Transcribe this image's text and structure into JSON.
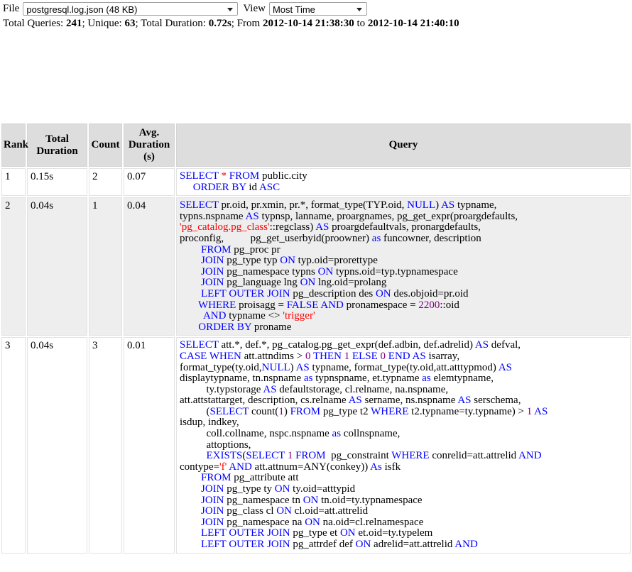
{
  "toolbar": {
    "file_label": "File",
    "file_select_value": "postgresql.log.json (48 KB)",
    "view_label": "View",
    "view_select_value": "Most Time"
  },
  "summary": {
    "total_queries_label": "Total Queries:",
    "total_queries_value": "241",
    "sep1": ";",
    "unique_label": "Unique:",
    "unique_value": "63",
    "sep2": ";",
    "duration_label": "Total Duration:",
    "duration_value": "0.72s",
    "sep3": ";",
    "from_label": "From",
    "from_value": "2012-10-14 21:38:30",
    "to_label": "to",
    "to_value": "2012-10-14 21:40:10"
  },
  "table": {
    "headers": {
      "rank": "Rank",
      "total_duration": "Total Duration",
      "count": "Count",
      "avg_duration": "Avg. Duration (s)",
      "query": "Query"
    },
    "rows": [
      {
        "rank": "1",
        "total_duration": "0.15s",
        "count": "2",
        "avg_duration": "0.07",
        "query_tokens": [
          {
            "t": "SELECT",
            "c": "kw"
          },
          {
            "t": " ",
            "c": ""
          },
          {
            "t": "*",
            "c": "str"
          },
          {
            "t": " ",
            "c": ""
          },
          {
            "t": "FROM",
            "c": "kw"
          },
          {
            "t": " public.city\n     ",
            "c": ""
          },
          {
            "t": "ORDER",
            "c": "kw"
          },
          {
            "t": " ",
            "c": ""
          },
          {
            "t": "BY",
            "c": "kw"
          },
          {
            "t": " id ",
            "c": ""
          },
          {
            "t": "ASC",
            "c": "kw"
          }
        ]
      },
      {
        "rank": "2",
        "total_duration": "0.04s",
        "count": "1",
        "avg_duration": "0.04",
        "query_tokens": [
          {
            "t": "SELECT",
            "c": "kw"
          },
          {
            "t": " pr.oid, pr.xmin, pr.*, format_type(TYP.oid, ",
            "c": ""
          },
          {
            "t": "NULL",
            "c": "kw"
          },
          {
            "t": ") ",
            "c": ""
          },
          {
            "t": "AS",
            "c": "kw"
          },
          {
            "t": " typname,\ntypns.nspname ",
            "c": ""
          },
          {
            "t": "AS",
            "c": "kw"
          },
          {
            "t": " typnsp, lanname, proargnames, pg_get_expr(proargdefaults,\n",
            "c": ""
          },
          {
            "t": "'pg_catalog.pg_class'",
            "c": "str"
          },
          {
            "t": "::regclass) ",
            "c": ""
          },
          {
            "t": "AS",
            "c": "kw"
          },
          {
            "t": " proargdefaultvals, pronargdefaults,\nproconfig,          pg_get_userbyid(proowner) ",
            "c": ""
          },
          {
            "t": "as",
            "c": "kw"
          },
          {
            "t": " funcowner, description\n        ",
            "c": ""
          },
          {
            "t": "FROM",
            "c": "kw"
          },
          {
            "t": " pg_proc pr\n        ",
            "c": ""
          },
          {
            "t": "JOIN",
            "c": "kw"
          },
          {
            "t": " pg_type typ ",
            "c": ""
          },
          {
            "t": "ON",
            "c": "kw"
          },
          {
            "t": " typ.oid=prorettype\n        ",
            "c": ""
          },
          {
            "t": "JOIN",
            "c": "kw"
          },
          {
            "t": " pg_namespace typns ",
            "c": ""
          },
          {
            "t": "ON",
            "c": "kw"
          },
          {
            "t": " typns.oid=typ.typnamespace\n        ",
            "c": ""
          },
          {
            "t": "JOIN",
            "c": "kw"
          },
          {
            "t": " pg_language lng ",
            "c": ""
          },
          {
            "t": "ON",
            "c": "kw"
          },
          {
            "t": " lng.oid=prolang\n        ",
            "c": ""
          },
          {
            "t": "LEFT",
            "c": "kw"
          },
          {
            "t": " ",
            "c": ""
          },
          {
            "t": "OUTER",
            "c": "kw"
          },
          {
            "t": " ",
            "c": ""
          },
          {
            "t": "JOIN",
            "c": "kw"
          },
          {
            "t": " pg_description des ",
            "c": ""
          },
          {
            "t": "ON",
            "c": "kw"
          },
          {
            "t": " des.objoid=pr.oid\n       ",
            "c": ""
          },
          {
            "t": "WHERE",
            "c": "kw"
          },
          {
            "t": " proisagg = ",
            "c": ""
          },
          {
            "t": "FALSE",
            "c": "kw"
          },
          {
            "t": " ",
            "c": ""
          },
          {
            "t": "AND",
            "c": "kw"
          },
          {
            "t": " pronamespace = ",
            "c": ""
          },
          {
            "t": "2200",
            "c": "num2"
          },
          {
            "t": "::oid\n         ",
            "c": ""
          },
          {
            "t": "AND",
            "c": "kw"
          },
          {
            "t": " typname <> ",
            "c": ""
          },
          {
            "t": "'trigger'",
            "c": "str"
          },
          {
            "t": "\n       ",
            "c": ""
          },
          {
            "t": "ORDER",
            "c": "kw"
          },
          {
            "t": " ",
            "c": ""
          },
          {
            "t": "BY",
            "c": "kw"
          },
          {
            "t": " proname",
            "c": ""
          }
        ]
      },
      {
        "rank": "3",
        "total_duration": "0.04s",
        "count": "3",
        "avg_duration": "0.01",
        "query_tokens": [
          {
            "t": "SELECT",
            "c": "kw"
          },
          {
            "t": " att.*, def.*, pg_catalog.pg_get_expr(def.adbin, def.adrelid) ",
            "c": ""
          },
          {
            "t": "AS",
            "c": "kw"
          },
          {
            "t": " defval,\n",
            "c": ""
          },
          {
            "t": "CASE",
            "c": "kw"
          },
          {
            "t": " ",
            "c": ""
          },
          {
            "t": "WHEN",
            "c": "kw"
          },
          {
            "t": " att.attndims > ",
            "c": ""
          },
          {
            "t": "0",
            "c": "num2"
          },
          {
            "t": " ",
            "c": ""
          },
          {
            "t": "THEN",
            "c": "kw"
          },
          {
            "t": " ",
            "c": ""
          },
          {
            "t": "1",
            "c": "num2"
          },
          {
            "t": " ",
            "c": ""
          },
          {
            "t": "ELSE",
            "c": "kw"
          },
          {
            "t": " ",
            "c": ""
          },
          {
            "t": "0",
            "c": "num2"
          },
          {
            "t": " ",
            "c": ""
          },
          {
            "t": "END",
            "c": "kw"
          },
          {
            "t": " ",
            "c": ""
          },
          {
            "t": "AS",
            "c": "kw"
          },
          {
            "t": " isarray,\nformat_type(ty.oid,",
            "c": ""
          },
          {
            "t": "NULL",
            "c": "kw"
          },
          {
            "t": ") ",
            "c": ""
          },
          {
            "t": "AS",
            "c": "kw"
          },
          {
            "t": " typname, format_type(ty.oid,att.atttypmod) ",
            "c": ""
          },
          {
            "t": "AS",
            "c": "kw"
          },
          {
            "t": "\ndisplaytypname, tn.nspname ",
            "c": ""
          },
          {
            "t": "as",
            "c": "kw"
          },
          {
            "t": " typnspname, et.typname ",
            "c": ""
          },
          {
            "t": "as",
            "c": "kw"
          },
          {
            "t": " elemtypname,\n          ty.typstorage ",
            "c": ""
          },
          {
            "t": "AS",
            "c": "kw"
          },
          {
            "t": " defaultstorage, cl.relname, na.nspname,\natt.attstattarget, description, cs.relname ",
            "c": ""
          },
          {
            "t": "AS",
            "c": "kw"
          },
          {
            "t": " sername, ns.nspname ",
            "c": ""
          },
          {
            "t": "AS",
            "c": "kw"
          },
          {
            "t": " serschema,\n          (",
            "c": ""
          },
          {
            "t": "SELECT",
            "c": "kw"
          },
          {
            "t": " count(",
            "c": ""
          },
          {
            "t": "1",
            "c": "num2"
          },
          {
            "t": ") ",
            "c": ""
          },
          {
            "t": "FROM",
            "c": "kw"
          },
          {
            "t": " pg_type t2 ",
            "c": ""
          },
          {
            "t": "WHERE",
            "c": "kw"
          },
          {
            "t": " t2.typname=ty.typname) > ",
            "c": ""
          },
          {
            "t": "1",
            "c": "num2"
          },
          {
            "t": " ",
            "c": ""
          },
          {
            "t": "AS",
            "c": "kw"
          },
          {
            "t": "\nisdup, indkey,\n          coll.collname, nspc.nspname ",
            "c": ""
          },
          {
            "t": "as",
            "c": "kw"
          },
          {
            "t": " collnspname,\n          attoptions,\n          ",
            "c": ""
          },
          {
            "t": "EXISTS",
            "c": "kw"
          },
          {
            "t": "(",
            "c": ""
          },
          {
            "t": "SELECT",
            "c": "kw"
          },
          {
            "t": " ",
            "c": ""
          },
          {
            "t": "1",
            "c": "num2"
          },
          {
            "t": " ",
            "c": ""
          },
          {
            "t": "FROM",
            "c": "kw"
          },
          {
            "t": "  pg_constraint ",
            "c": ""
          },
          {
            "t": "WHERE",
            "c": "kw"
          },
          {
            "t": " conrelid=att.attrelid ",
            "c": ""
          },
          {
            "t": "AND",
            "c": "kw"
          },
          {
            "t": "\ncontype=",
            "c": ""
          },
          {
            "t": "'f'",
            "c": "str"
          },
          {
            "t": " ",
            "c": ""
          },
          {
            "t": "AND",
            "c": "kw"
          },
          {
            "t": " att.attnum=ANY(conkey)) ",
            "c": ""
          },
          {
            "t": "As",
            "c": "kw"
          },
          {
            "t": " isfk\n        ",
            "c": ""
          },
          {
            "t": "FROM",
            "c": "kw"
          },
          {
            "t": " pg_attribute att\n        ",
            "c": ""
          },
          {
            "t": "JOIN",
            "c": "kw"
          },
          {
            "t": " pg_type ty ",
            "c": ""
          },
          {
            "t": "ON",
            "c": "kw"
          },
          {
            "t": " ty.oid=atttypid\n        ",
            "c": ""
          },
          {
            "t": "JOIN",
            "c": "kw"
          },
          {
            "t": " pg_namespace tn ",
            "c": ""
          },
          {
            "t": "ON",
            "c": "kw"
          },
          {
            "t": " tn.oid=ty.typnamespace\n        ",
            "c": ""
          },
          {
            "t": "JOIN",
            "c": "kw"
          },
          {
            "t": " pg_class cl ",
            "c": ""
          },
          {
            "t": "ON",
            "c": "kw"
          },
          {
            "t": " cl.oid=att.attrelid\n        ",
            "c": ""
          },
          {
            "t": "JOIN",
            "c": "kw"
          },
          {
            "t": " pg_namespace na ",
            "c": ""
          },
          {
            "t": "ON",
            "c": "kw"
          },
          {
            "t": " na.oid=cl.relnamespace\n        ",
            "c": ""
          },
          {
            "t": "LEFT",
            "c": "kw"
          },
          {
            "t": " ",
            "c": ""
          },
          {
            "t": "OUTER",
            "c": "kw"
          },
          {
            "t": " ",
            "c": ""
          },
          {
            "t": "JOIN",
            "c": "kw"
          },
          {
            "t": " pg_type et ",
            "c": ""
          },
          {
            "t": "ON",
            "c": "kw"
          },
          {
            "t": " et.oid=ty.typelem\n        ",
            "c": ""
          },
          {
            "t": "LEFT",
            "c": "kw"
          },
          {
            "t": " ",
            "c": ""
          },
          {
            "t": "OUTER",
            "c": "kw"
          },
          {
            "t": " ",
            "c": ""
          },
          {
            "t": "JOIN",
            "c": "kw"
          },
          {
            "t": " pg_attrdef def ",
            "c": ""
          },
          {
            "t": "ON",
            "c": "kw"
          },
          {
            "t": " adrelid=att.attrelid ",
            "c": ""
          },
          {
            "t": "AND",
            "c": "kw"
          }
        ]
      }
    ]
  }
}
